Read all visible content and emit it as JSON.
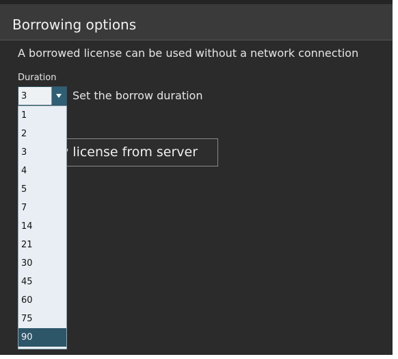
{
  "section": {
    "title": "Borrowing options"
  },
  "description": "A borrowed license can be used without a network connection",
  "duration": {
    "label": "Duration",
    "selected_value": "3",
    "hint": "Set the borrow duration",
    "options": [
      "1",
      "2",
      "3",
      "4",
      "5",
      "7",
      "14",
      "21",
      "30",
      "45",
      "60",
      "75",
      "90"
    ],
    "highlighted_option": "90"
  },
  "actions": {
    "borrow_button_visible_label": "v license from server"
  },
  "colors": {
    "panel_background": "#2b2b2b",
    "header_background": "#3a3a3a",
    "dropdown_background": "#e8eef3",
    "selected_item": "#2d5669",
    "toggle": "#2f5f75"
  },
  "icons": {
    "dropdown_toggle": "chevron-down-icon"
  }
}
